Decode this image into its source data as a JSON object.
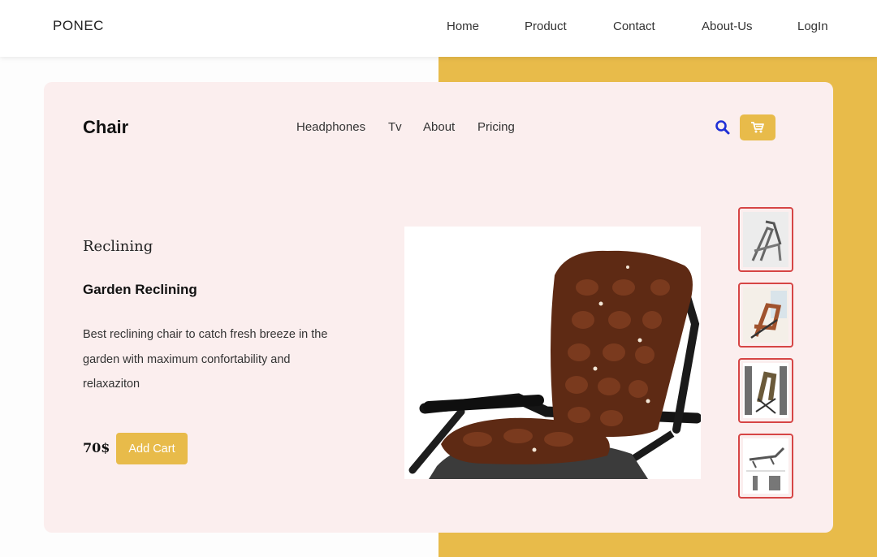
{
  "topbar": {
    "brand": "PONEC",
    "nav": [
      "Home",
      "Product",
      "Contact",
      "About-Us",
      "LogIn"
    ]
  },
  "card": {
    "brand": "Chair",
    "nav": [
      "Headphones",
      "Tv",
      "About",
      "Pricing"
    ],
    "icons": {
      "search": "search-icon",
      "cart": "cart-icon"
    }
  },
  "product": {
    "category": "Reclining",
    "name": "Garden Reclining",
    "description": "Best reclining chair to catch fresh breeze in the garden with maximum confortability and relaxaziton",
    "price": "70$",
    "add_cart_label": "Add Cart"
  },
  "colors": {
    "accent": "#e8bb4a",
    "card_bg": "#fbeeee",
    "thumb_border": "#d64545",
    "search_icon": "#1f2fd6"
  }
}
